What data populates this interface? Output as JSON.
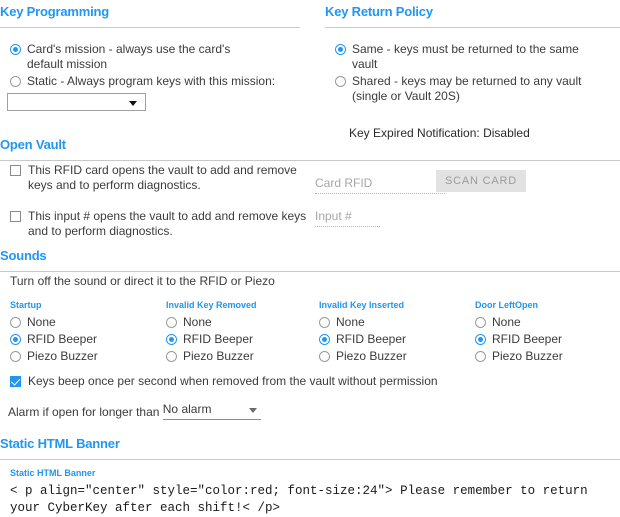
{
  "sections": {
    "key_programming": {
      "title": "Key Programming",
      "options": [
        {
          "label": "Card's mission - always use the card's default mission",
          "selected": true
        },
        {
          "label": "Static - Always program keys with this mission:",
          "selected": false
        }
      ],
      "mission_select": {
        "value": "",
        "placeholder": ""
      }
    },
    "key_return_policy": {
      "title": "Key Return Policy",
      "options": [
        {
          "label": "Same - keys must be returned to the same vault",
          "selected": true
        },
        {
          "label": "Shared - keys may be returned to any vault (single or Vault 20S)",
          "selected": false
        }
      ],
      "expired_notification": "Key Expired Notification: Disabled"
    },
    "open_vault": {
      "title": "Open Vault",
      "checkboxes": [
        {
          "label": "This RFID card opens the vault to add and remove keys and to perform diagnostics.",
          "checked": false
        },
        {
          "label": "This input # opens the vault to add and remove keys and to perform diagnostics.",
          "checked": false
        }
      ],
      "card_rfid": {
        "label": "Card RFID",
        "value": ""
      },
      "input_num": {
        "label": "Input #",
        "value": ""
      },
      "scan_button": "SCAN CARD"
    },
    "sounds": {
      "title": "Sounds",
      "hint": "Turn off the sound or direct it to the RFID or Piezo",
      "groups": [
        {
          "name": "Startup",
          "options": [
            {
              "label": "None",
              "selected": false
            },
            {
              "label": "RFID Beeper",
              "selected": true
            },
            {
              "label": "Piezo Buzzer",
              "selected": false
            }
          ]
        },
        {
          "name": "Invalid Key Removed",
          "options": [
            {
              "label": "None",
              "selected": false
            },
            {
              "label": "RFID Beeper",
              "selected": true
            },
            {
              "label": "Piezo Buzzer",
              "selected": false
            }
          ]
        },
        {
          "name": "Invalid Key Inserted",
          "options": [
            {
              "label": "None",
              "selected": false
            },
            {
              "label": "RFID Beeper",
              "selected": true
            },
            {
              "label": "Piezo Buzzer",
              "selected": false
            }
          ]
        },
        {
          "name": "Door LeftOpen",
          "options": [
            {
              "label": "None",
              "selected": false
            },
            {
              "label": "RFID Beeper",
              "selected": true
            },
            {
              "label": "Piezo Buzzer",
              "selected": false
            }
          ]
        }
      ],
      "beep_checkbox": {
        "label": "Keys beep once per second when removed from the vault without permission",
        "checked": true
      },
      "alarm": {
        "label": "Alarm if open for longer than",
        "value": "No alarm"
      }
    },
    "static_html_banner": {
      "title": "Static HTML Banner",
      "field_label": "Static HTML Banner",
      "value": "< p align=\"center\" style=\"color:red; font-size:24\"> Please remember to return your CyberKey after each shift!< /p>"
    }
  },
  "colors": {
    "accent": "#2196f3",
    "text": "#3b3b3b",
    "rule": "#c8c8c8",
    "disabled": "#a6a6a6"
  }
}
